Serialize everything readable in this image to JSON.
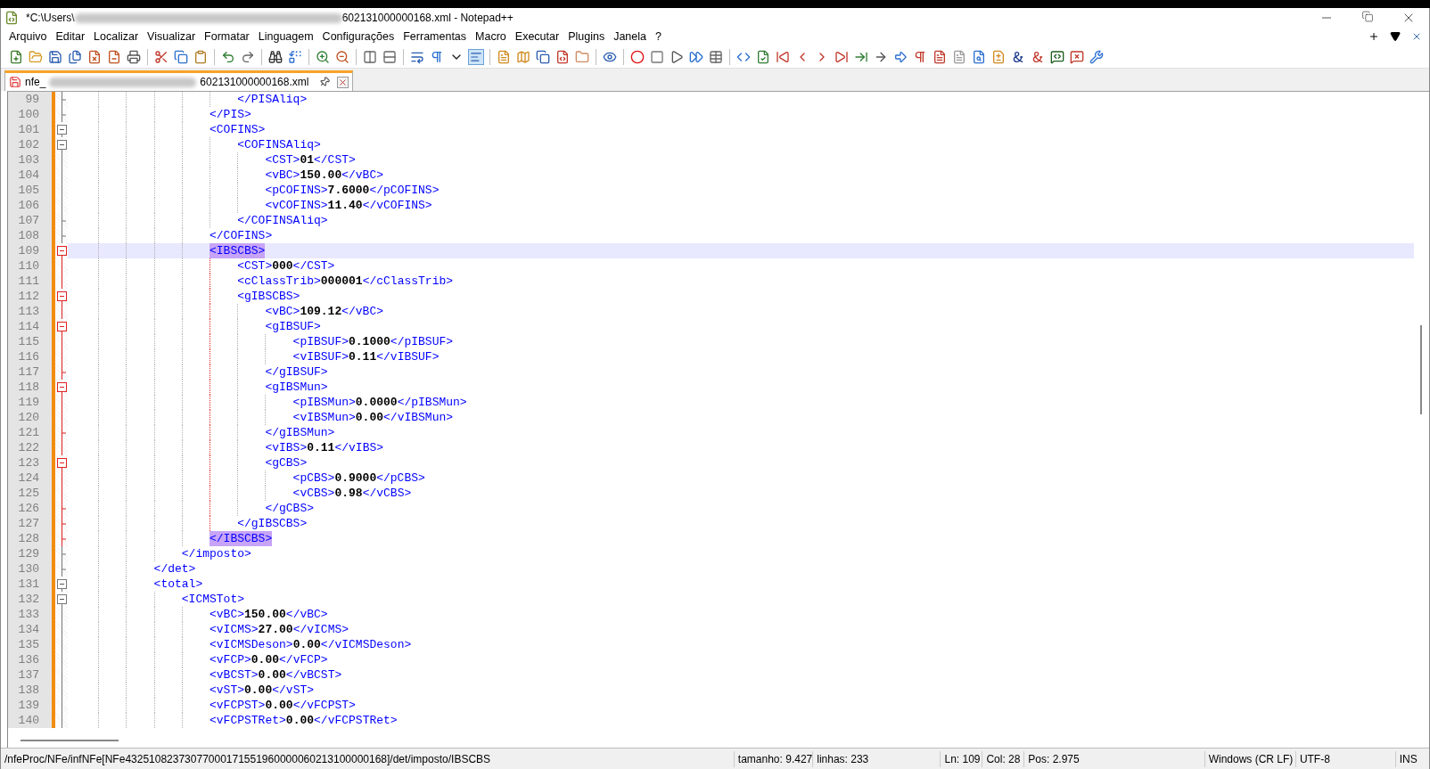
{
  "window": {
    "title_start": "*C:\\Users\\",
    "title_end": "602131000000168.xml - Notepad++"
  },
  "menu": [
    "Arquivo",
    "Editar",
    "Localizar",
    "Visualizar",
    "Formatar",
    "Linguagem",
    "Configurações",
    "Ferramentas",
    "Macro",
    "Executar",
    "Plugins",
    "Janela",
    "?"
  ],
  "tabs": [
    {
      "label_start": "nfe_",
      "label_end": "602131000000168.xml",
      "selected": true,
      "modified": true
    }
  ],
  "editor": {
    "lines": [
      {
        "number": "99",
        "text": "\t\t\t\t\t\t</PISAliq>",
        "kind": "close",
        "active": false,
        "selected": false,
        "match": false
      },
      {
        "number": "100",
        "text": "\t\t\t\t\t</PIS>",
        "kind": "close",
        "active": false,
        "selected": false,
        "match": false
      },
      {
        "number": "101",
        "text": "\t\t\t\t\t<COFINS>",
        "kind": "open",
        "active": false,
        "selected": false,
        "match": false
      },
      {
        "number": "102",
        "text": "\t\t\t\t\t\t<COFINSAliq>",
        "kind": "open",
        "active": false,
        "selected": false,
        "match": false
      },
      {
        "number": "103",
        "text": "\t\t\t\t\t\t\t<CST>01</CST>",
        "kind": "body",
        "active": false,
        "selected": false,
        "match": false
      },
      {
        "number": "104",
        "text": "\t\t\t\t\t\t\t<vBC>150.00</vBC>",
        "kind": "body",
        "active": false,
        "selected": false,
        "match": false
      },
      {
        "number": "105",
        "text": "\t\t\t\t\t\t\t<pCOFINS>7.6000</pCOFINS>",
        "kind": "body",
        "active": false,
        "selected": false,
        "match": false
      },
      {
        "number": "106",
        "text": "\t\t\t\t\t\t\t<vCOFINS>11.40</vCOFINS>",
        "kind": "body",
        "active": false,
        "selected": false,
        "match": false
      },
      {
        "number": "107",
        "text": "\t\t\t\t\t\t</COFINSAliq>",
        "kind": "close",
        "active": false,
        "selected": false,
        "match": false
      },
      {
        "number": "108",
        "text": "\t\t\t\t\t</COFINS>",
        "kind": "close",
        "active": false,
        "selected": false,
        "match": false
      },
      {
        "number": "109",
        "text": "\t\t\t\t\t<IBSCBS>",
        "kind": "open",
        "active": true,
        "selected": true,
        "match": true
      },
      {
        "number": "110",
        "text": "\t\t\t\t\t\t<CST>000</CST>",
        "kind": "body",
        "active": true,
        "selected": false,
        "match": false
      },
      {
        "number": "111",
        "text": "\t\t\t\t\t\t<cClassTrib>000001</cClassTrib>",
        "kind": "body",
        "active": true,
        "selected": false,
        "match": false
      },
      {
        "number": "112",
        "text": "\t\t\t\t\t\t<gIBSCBS>",
        "kind": "open",
        "active": true,
        "selected": false,
        "match": false
      },
      {
        "number": "113",
        "text": "\t\t\t\t\t\t\t<vBC>109.12</vBC>",
        "kind": "body",
        "active": true,
        "selected": false,
        "match": false
      },
      {
        "number": "114",
        "text": "\t\t\t\t\t\t\t<gIBSUF>",
        "kind": "open",
        "active": true,
        "selected": false,
        "match": false
      },
      {
        "number": "115",
        "text": "\t\t\t\t\t\t\t\t<pIBSUF>0.1000</pIBSUF>",
        "kind": "body",
        "active": true,
        "selected": false,
        "match": false
      },
      {
        "number": "116",
        "text": "\t\t\t\t\t\t\t\t<vIBSUF>0.11</vIBSUF>",
        "kind": "body",
        "active": true,
        "selected": false,
        "match": false
      },
      {
        "number": "117",
        "text": "\t\t\t\t\t\t\t</gIBSUF>",
        "kind": "close",
        "active": true,
        "selected": false,
        "match": false
      },
      {
        "number": "118",
        "text": "\t\t\t\t\t\t\t<gIBSMun>",
        "kind": "open",
        "active": true,
        "selected": false,
        "match": false
      },
      {
        "number": "119",
        "text": "\t\t\t\t\t\t\t\t<pIBSMun>0.0000</pIBSMun>",
        "kind": "body",
        "active": true,
        "selected": false,
        "match": false
      },
      {
        "number": "120",
        "text": "\t\t\t\t\t\t\t\t<vIBSMun>0.00</vIBSMun>",
        "kind": "body",
        "active": true,
        "selected": false,
        "match": false
      },
      {
        "number": "121",
        "text": "\t\t\t\t\t\t\t</gIBSMun>",
        "kind": "close",
        "active": true,
        "selected": false,
        "match": false
      },
      {
        "number": "122",
        "text": "\t\t\t\t\t\t\t<vIBS>0.11</vIBS>",
        "kind": "body",
        "active": true,
        "selected": false,
        "match": false
      },
      {
        "number": "123",
        "text": "\t\t\t\t\t\t\t<gCBS>",
        "kind": "open",
        "active": true,
        "selected": false,
        "match": false
      },
      {
        "number": "124",
        "text": "\t\t\t\t\t\t\t\t<pCBS>0.9000</pCBS>",
        "kind": "body",
        "active": true,
        "selected": false,
        "match": false
      },
      {
        "number": "125",
        "text": "\t\t\t\t\t\t\t\t<vCBS>0.98</vCBS>",
        "kind": "body",
        "active": true,
        "selected": false,
        "match": false
      },
      {
        "number": "126",
        "text": "\t\t\t\t\t\t\t</gCBS>",
        "kind": "close",
        "active": true,
        "selected": false,
        "match": false
      },
      {
        "number": "127",
        "text": "\t\t\t\t\t\t</gIBSCBS>",
        "kind": "close",
        "active": true,
        "selected": false,
        "match": false
      },
      {
        "number": "128",
        "text": "\t\t\t\t\t</IBSCBS>",
        "kind": "close",
        "active": true,
        "selected": false,
        "match": true
      },
      {
        "number": "129",
        "text": "\t\t\t\t</imposto>",
        "kind": "close",
        "active": false,
        "selected": false,
        "match": false
      },
      {
        "number": "130",
        "text": "\t\t\t</det>",
        "kind": "close",
        "active": false,
        "selected": false,
        "match": false
      },
      {
        "number": "131",
        "text": "\t\t\t<total>",
        "kind": "open",
        "active": false,
        "selected": false,
        "match": false
      },
      {
        "number": "132",
        "text": "\t\t\t\t<ICMSTot>",
        "kind": "open",
        "active": false,
        "selected": false,
        "match": false
      },
      {
        "number": "133",
        "text": "\t\t\t\t\t<vBC>150.00</vBC>",
        "kind": "body",
        "active": false,
        "selected": false,
        "match": false
      },
      {
        "number": "134",
        "text": "\t\t\t\t\t<vICMS>27.00</vICMS>",
        "kind": "body",
        "active": false,
        "selected": false,
        "match": false
      },
      {
        "number": "135",
        "text": "\t\t\t\t\t<vICMSDeson>0.00</vICMSDeson>",
        "kind": "body",
        "active": false,
        "selected": false,
        "match": false
      },
      {
        "number": "136",
        "text": "\t\t\t\t\t<vFCP>0.00</vFCP>",
        "kind": "body",
        "active": false,
        "selected": false,
        "match": false
      },
      {
        "number": "137",
        "text": "\t\t\t\t\t<vBCST>0.00</vBCST>",
        "kind": "body",
        "active": false,
        "selected": false,
        "match": false
      },
      {
        "number": "138",
        "text": "\t\t\t\t\t<vST>0.00</vST>",
        "kind": "body",
        "active": false,
        "selected": false,
        "match": false
      },
      {
        "number": "139",
        "text": "\t\t\t\t\t<vFCPST>0.00</vFCPST>",
        "kind": "body",
        "active": false,
        "selected": false,
        "match": false
      },
      {
        "number": "140",
        "text": "\t\t\t\t\t<vFCPSTRet>0.00</vFCPSTRet>",
        "kind": "body",
        "active": false,
        "selected": false,
        "match": false
      }
    ]
  },
  "status_bar": {
    "path": "/nfeProc/NFe/infNFe[NFe43251082373077000171551960000060213100000168]/det/imposto/IBSCBS",
    "fields": [
      "tamanho: 9.427",
      "linhas: 233",
      "Ln: 109",
      "Col: 28",
      "Pos: 2.975",
      "Windows (CR LF)",
      "UTF-8",
      "INS"
    ]
  }
}
